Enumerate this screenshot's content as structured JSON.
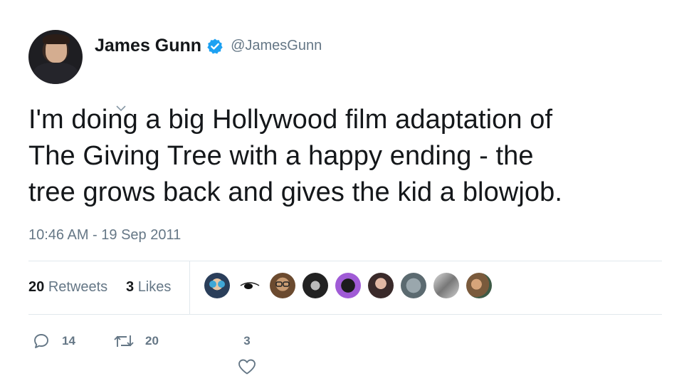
{
  "user": {
    "display_name": "James Gunn",
    "handle": "@JamesGunn",
    "verified": true
  },
  "tweet": {
    "lines": [
      "I'm doing a big Hollywood film adaptation of",
      "The Giving Tree with a happy ending - the",
      "tree grows back and gives the kid a blowjob."
    ],
    "timestamp": "10:46 AM - 19 Sep 2011"
  },
  "stats": {
    "retweets_count": "20",
    "retweets_label": "Retweets",
    "likes_count": "3",
    "likes_label": "Likes"
  },
  "likers": [
    "avatar-sunglasses",
    "avatar-eyepatch",
    "avatar-glasses-man",
    "avatar-dark-figure",
    "avatar-purple-cat",
    "avatar-woman",
    "avatar-cat",
    "avatar-group-photo",
    "avatar-couple"
  ],
  "actions": {
    "reply_count": "14",
    "retweet_count": "20",
    "like_count": "3"
  },
  "icons": {
    "verified": "verified-badge-icon",
    "reply": "reply-icon",
    "retweet": "retweet-icon",
    "like": "heart-icon",
    "caret": "chevron-down-icon"
  },
  "colors": {
    "verified_blue": "#1da1f2",
    "secondary_text": "#657786",
    "primary_text": "#14171a",
    "divider": "#e1e8ed"
  }
}
